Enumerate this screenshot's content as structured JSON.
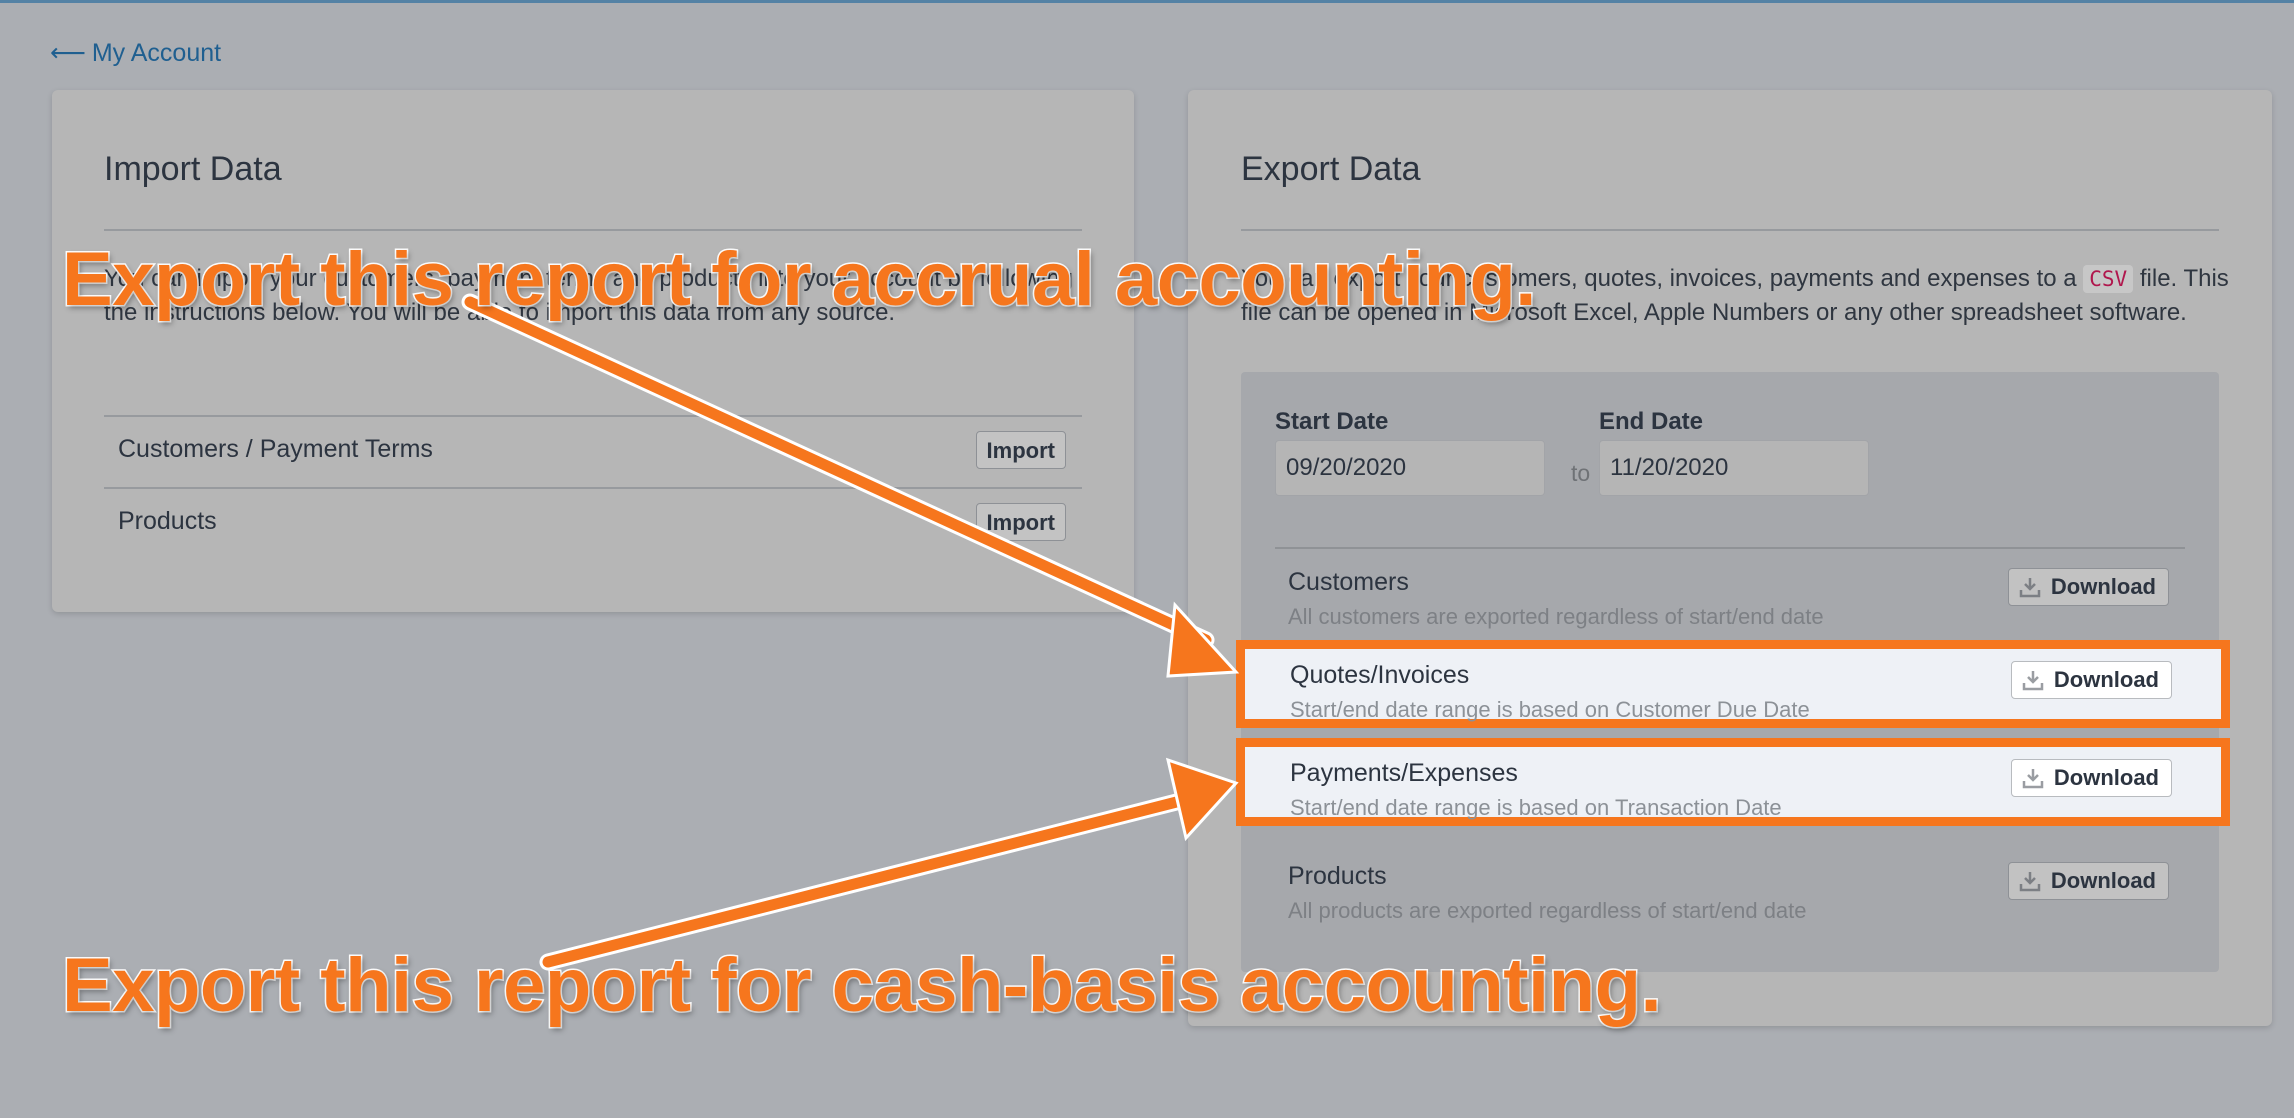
{
  "nav": {
    "back_arrow": "⟵",
    "back_label": "My Account"
  },
  "import": {
    "title": "Import Data",
    "description": "You can import your customers, payment terms and products into your account by following the instructions below. You will be able to import this data from any source.",
    "rows": [
      {
        "label": "Customers / Payment Terms",
        "button": "Import"
      },
      {
        "label": "Products",
        "button": "Import"
      }
    ]
  },
  "export": {
    "title": "Export Data",
    "description_pre": "You can export your customers, quotes, invoices, payments and expenses to a",
    "csv": "CSV",
    "description_post": "file. This file can be opened in Microsoft Excel, Apple Numbers or any other spreadsheet software.",
    "start_label": "Start Date",
    "start_value": "09/20/2020",
    "to_label": "to",
    "end_label": "End Date",
    "end_value": "11/20/2020",
    "rows": [
      {
        "title": "Customers",
        "sub": "All customers are exported regardless of start/end date",
        "button": "Download"
      },
      {
        "title": "Quotes/Invoices",
        "sub": "Start/end date range is based on Customer Due Date",
        "button": "Download"
      },
      {
        "title": "Payments/Expenses",
        "sub": "Start/end date range is based on Transaction Date",
        "button": "Download"
      },
      {
        "title": "Products",
        "sub": "All products are exported regardless of start/end date",
        "button": "Download"
      }
    ]
  },
  "annotations": {
    "accrual": "Export this report for accrual accounting.",
    "cash": "Export this report for cash-basis accounting."
  },
  "colors": {
    "accent_orange": "#f6761d",
    "link_blue": "#1f5f90",
    "csv_red": "#b0174d"
  },
  "icons": {
    "download": "download-icon",
    "back": "back-arrow-icon"
  }
}
